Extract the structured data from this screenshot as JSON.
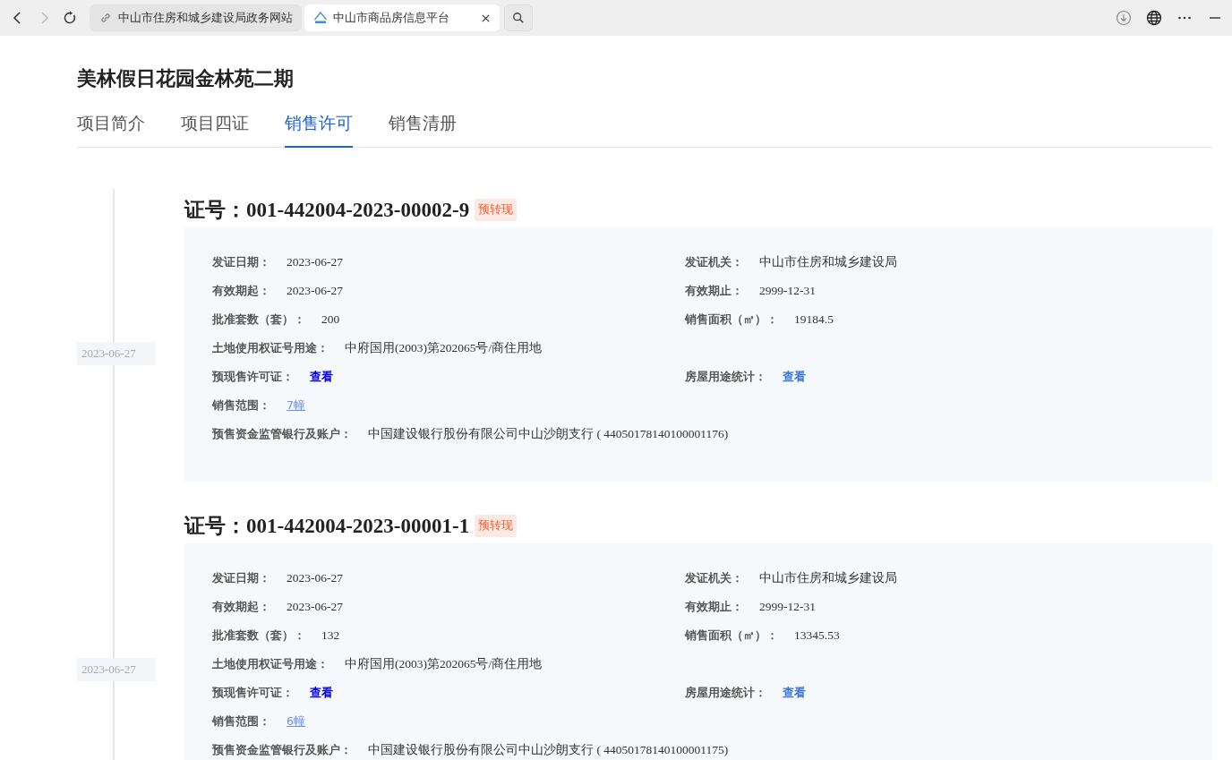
{
  "browser": {
    "tabs": [
      {
        "title": "中山市住房和城乡建设局政务网站",
        "selected": false
      },
      {
        "title": "中山市商品房信息平台",
        "selected": true
      }
    ]
  },
  "project": {
    "title": "美林假日花园金林苑二期"
  },
  "tabs": [
    {
      "label": "项目简介",
      "selected": false
    },
    {
      "label": "项目四证",
      "selected": false
    },
    {
      "label": "销售许可",
      "selected": true
    },
    {
      "label": "销售清册",
      "selected": false
    }
  ],
  "permits": [
    {
      "date": "2023-06-27",
      "heading": "证号：001-442004-2023-00002-9",
      "tag": "预转现",
      "rows": [
        [
          {
            "label": "发证日期：",
            "value": "2023-06-27",
            "kind": "text"
          },
          {
            "label": "发证机关：",
            "value": "中山市住房和城乡建设局",
            "kind": "text"
          }
        ],
        [
          {
            "label": "有效期起：",
            "value": "2023-06-27",
            "kind": "text"
          },
          {
            "label": "有效期止：",
            "value": "2999-12-31",
            "kind": "text"
          }
        ],
        [
          {
            "label": "批准套数（套）：",
            "value": "200",
            "kind": "text"
          },
          {
            "label": "销售面积（㎡）：",
            "value": "19184.5",
            "kind": "text"
          }
        ],
        [
          {
            "label": "土地使用权证号用途：",
            "value": "中府国用(2003)第202065号/商住用地",
            "kind": "text"
          }
        ],
        [
          {
            "label": "预现售许可证：",
            "value": "查看",
            "kind": "link-strong"
          },
          {
            "label": "房屋用途统计：",
            "value": "查看",
            "kind": "link"
          }
        ],
        [
          {
            "label": "销售范围：",
            "value": "7幢",
            "kind": "link-underlined"
          }
        ],
        [
          {
            "label": "预售资金监管银行及账户：",
            "value": "中国建设银行股份有限公司中山沙朗支行 ( 44050178140100001176)",
            "kind": "text"
          }
        ]
      ]
    },
    {
      "date": "2023-06-27",
      "heading": "证号：001-442004-2023-00001-1",
      "tag": "预转现",
      "rows": [
        [
          {
            "label": "发证日期：",
            "value": "2023-06-27",
            "kind": "text"
          },
          {
            "label": "发证机关：",
            "value": "中山市住房和城乡建设局",
            "kind": "text"
          }
        ],
        [
          {
            "label": "有效期起：",
            "value": "2023-06-27",
            "kind": "text"
          },
          {
            "label": "有效期止：",
            "value": "2999-12-31",
            "kind": "text"
          }
        ],
        [
          {
            "label": "批准套数（套）：",
            "value": "132",
            "kind": "text"
          },
          {
            "label": "销售面积（㎡）：",
            "value": "13345.53",
            "kind": "text"
          }
        ],
        [
          {
            "label": "土地使用权证号用途：",
            "value": "中府国用(2003)第202065号/商住用地",
            "kind": "text"
          }
        ],
        [
          {
            "label": "预现售许可证：",
            "value": "查看",
            "kind": "link-strong"
          },
          {
            "label": "房屋用途统计：",
            "value": "查看",
            "kind": "link"
          }
        ],
        [
          {
            "label": "销售范围：",
            "value": "6幢",
            "kind": "link-underlined"
          }
        ],
        [
          {
            "label": "预售资金监管银行及账户：",
            "value": "中国建设银行股份有限公司中山沙朗支行 ( 44050178140100001175)",
            "kind": "text"
          }
        ]
      ]
    }
  ]
}
